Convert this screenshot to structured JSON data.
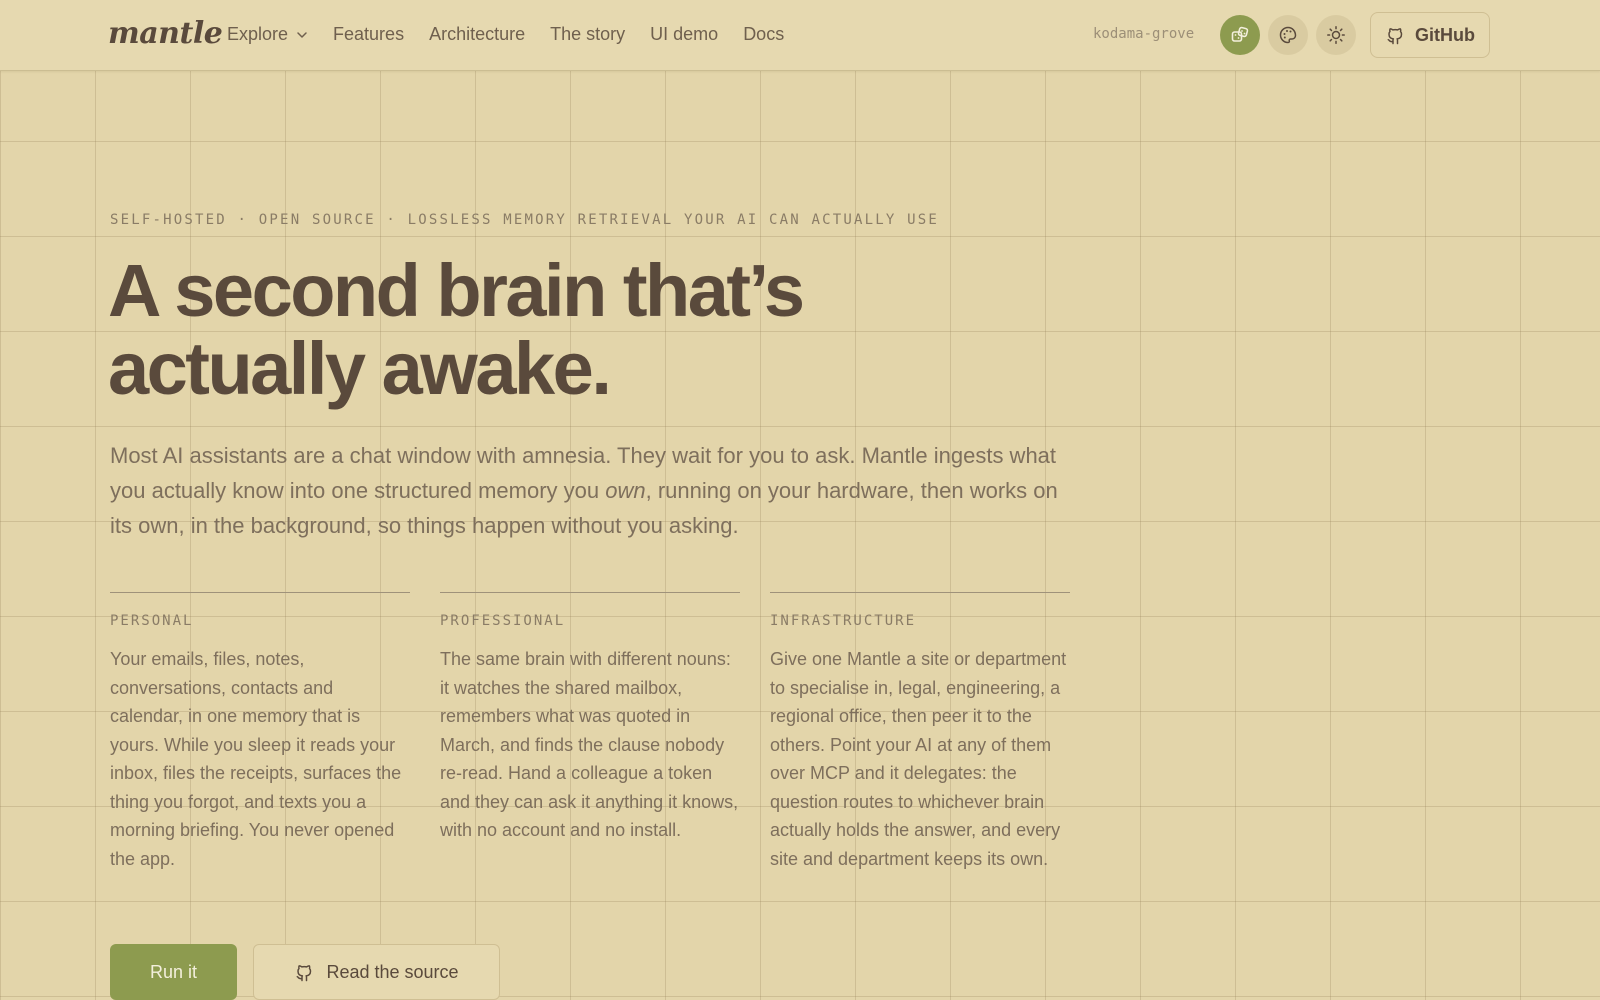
{
  "header": {
    "logo": "mantle",
    "nav": [
      {
        "label": "Explore",
        "has_dropdown": true
      },
      {
        "label": "Features"
      },
      {
        "label": "Architecture"
      },
      {
        "label": "The story"
      },
      {
        "label": "UI demo"
      },
      {
        "label": "Docs"
      }
    ],
    "username": "kodama-grove",
    "icons": [
      "dice-icon",
      "palette-icon",
      "sun-icon"
    ],
    "github_label": "GitHub"
  },
  "hero": {
    "eyebrow": "SELF-HOSTED · OPEN SOURCE · LOSSLESS MEMORY RETRIEVAL YOUR AI CAN ACTUALLY USE",
    "headline_line1": "A second brain that’s",
    "headline_line2": "actually awake.",
    "lede_part1": "Most AI assistants are a chat window with amnesia. They wait for you to ask. Mantle ingests what you actually know into one structured memory you ",
    "lede_em": "own",
    "lede_part2": ", running on your hardware, then works on its own, in the background, so things happen without you asking."
  },
  "columns": [
    {
      "title": "PERSONAL",
      "body": "Your emails, files, notes, conversations, contacts and calendar, in one memory that is yours. While you sleep it reads your inbox, files the receipts, surfaces the thing you forgot, and texts you a morning briefing. You never opened the app."
    },
    {
      "title": "PROFESSIONAL",
      "body": "The same brain with different nouns: it watches the shared mailbox, remembers what was quoted in March, and finds the clause nobody re-read. Hand a colleague a token and they can ask it anything it knows, with no account and no install."
    },
    {
      "title": "INFRASTRUCTURE",
      "body": "Give one Mantle a site or department to specialise in, legal, engineering, a regional office, then peer it to the others. Point your AI at any of them over MCP and it delegates: the question routes to whichever brain actually holds the answer, and every site and department keeps its own."
    }
  ],
  "cta": {
    "primary": "Run it",
    "secondary": "Read the source"
  },
  "colors": {
    "background": "#e3d5aa",
    "accent": "#8d9b4f",
    "text": "#5a4a3c"
  }
}
